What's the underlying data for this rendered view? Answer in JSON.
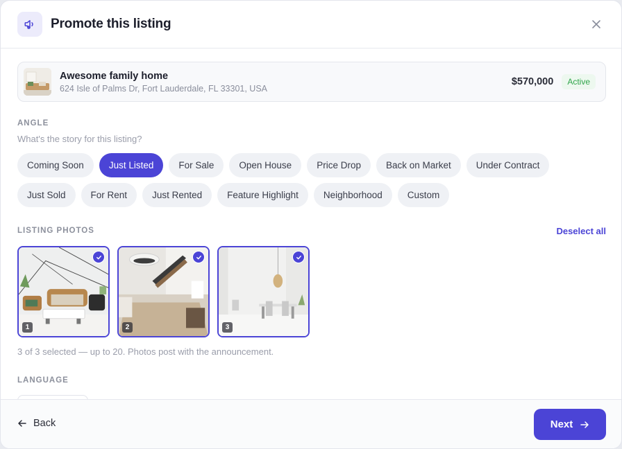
{
  "header": {
    "title": "Promote this listing",
    "icon": "megaphone-icon"
  },
  "listing": {
    "name": "Awesome family home",
    "address": "624 Isle of Palms Dr, Fort Lauderdale, FL 33301, USA",
    "price": "$570,000",
    "status": "Active"
  },
  "angle": {
    "label": "ANGLE",
    "hint": "What's the story for this listing?",
    "selected": "Just Listed",
    "chips_row1": [
      "Coming Soon",
      "Just Listed",
      "For Sale",
      "Open House",
      "Price Drop",
      "Back on Market",
      "Under Contract"
    ],
    "chips_row2": [
      "Just Sold",
      "For Rent",
      "Just Rented",
      "Feature Highlight",
      "Neighborhood",
      "Custom"
    ]
  },
  "photos": {
    "label": "LISTING PHOTOS",
    "deselect_label": "Deselect all",
    "items": [
      {
        "number": "1",
        "selected": true
      },
      {
        "number": "2",
        "selected": true
      },
      {
        "number": "3",
        "selected": true
      }
    ],
    "summary": "3 of 3 selected — up to 20. Photos post with the announcement."
  },
  "language": {
    "label": "LANGUAGE"
  },
  "footer": {
    "back_label": "Back",
    "next_label": "Next"
  },
  "colors": {
    "accent": "#4b44d6",
    "status": "#2fa54a"
  }
}
